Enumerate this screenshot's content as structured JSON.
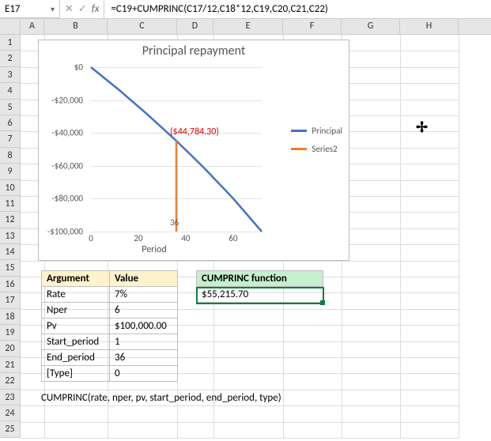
{
  "formula_bar": {
    "name_box": "E17",
    "fx_label": "fx",
    "formula": "=C19+CUMPRINC(C17/12,C18*12,C19,C20,C21,C22)"
  },
  "columns": [
    "A",
    "B",
    "C",
    "D",
    "E",
    "F",
    "G",
    "H"
  ],
  "rows": [
    "1",
    "2",
    "3",
    "4",
    "5",
    "6",
    "7",
    "8",
    "9",
    "10",
    "11",
    "12",
    "13",
    "14",
    "15",
    "16",
    "17",
    "18",
    "19",
    "20",
    "21",
    "22",
    "23",
    "24",
    "25"
  ],
  "arg_table": {
    "headers": [
      "Argument",
      "Value"
    ],
    "rows": [
      {
        "arg": "Rate",
        "val": "7%"
      },
      {
        "arg": "Nper",
        "val": "6"
      },
      {
        "arg": "Pv",
        "val": "$100,000.00"
      },
      {
        "arg": "Start_period",
        "val": "1"
      },
      {
        "arg": "End_period",
        "val": "36"
      },
      {
        "arg": "[Type]",
        "val": "0"
      }
    ]
  },
  "func_box": {
    "header": "CUMPRINC function",
    "value": "$55,215.70"
  },
  "signature": "CUMPRINC(rate, nper, pv, start_period, end_period, type)",
  "chart_data": {
    "type": "line",
    "title": "Principal repayment",
    "xlabel": "Period",
    "ylabel": "",
    "xlim": [
      0,
      72
    ],
    "ylim": [
      -100000,
      0
    ],
    "x_ticks": [
      0,
      20,
      40,
      60
    ],
    "y_ticks": [
      {
        "v": 0,
        "label": "$0"
      },
      {
        "v": -20000,
        "label": "-$20,000"
      },
      {
        "v": -40000,
        "label": "-$40,000"
      },
      {
        "v": -60000,
        "label": "-$60,000"
      },
      {
        "v": -80000,
        "label": "-$80,000"
      },
      {
        "v": -100000,
        "label": "-$100,000"
      }
    ],
    "series": [
      {
        "name": "Principal",
        "color": "#4472c4",
        "points": [
          {
            "x": 0,
            "y": 0
          },
          {
            "x": 12,
            "y": -14000
          },
          {
            "x": 24,
            "y": -29000
          },
          {
            "x": 36,
            "y": -44784.3
          },
          {
            "x": 48,
            "y": -61700
          },
          {
            "x": 60,
            "y": -79900
          },
          {
            "x": 72,
            "y": -100000
          }
        ]
      },
      {
        "name": "Series2",
        "color": "#ed7d31",
        "points": [
          {
            "x": 36,
            "y": -44784.3
          },
          {
            "x": 36,
            "y": -100000
          }
        ]
      }
    ],
    "annotation": {
      "x": 36,
      "y": -44784.3,
      "label": "($44,784.30)",
      "xlabel": "36"
    }
  }
}
